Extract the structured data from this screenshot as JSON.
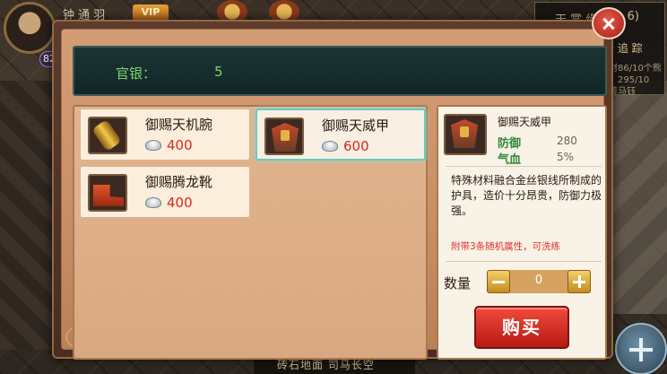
{
  "hud": {
    "player_name": "钟 通 羽",
    "vip_label": "VIP",
    "level": "82",
    "right_panel_title": "天 赏 缘",
    "right_panel_count": "6)",
    "right_panel_sub": "寿 追 踪",
    "right_panel_lines": [
      "材86/10个熊",
      "，295/10",
      "黄马钰"
    ],
    "location_text": "砖石地面    司马长空"
  },
  "dialog": {
    "silver_label": "官银：",
    "silver_value": "5",
    "items": [
      {
        "name": "御赐天机腕",
        "price": "400",
        "icon": "bracer-icon"
      },
      {
        "name": "御赐天威甲",
        "price": "600",
        "icon": "armor-icon"
      },
      {
        "name": "御赐腾龙靴",
        "price": "400",
        "icon": "boots-icon"
      }
    ],
    "detail": {
      "name": "御赐天威甲",
      "stat1_label": "防御",
      "stat1_value": "280",
      "stat2_label": "气血",
      "stat2_value": "5%",
      "description": "特殊材料融合金丝银线所制成的护具，造价十分昂贵，防御力极强。",
      "extra": "附带3条随机属性，可洗练",
      "quantity_label": "数量",
      "quantity_value": "0",
      "buy_label": "购买"
    }
  },
  "colors": {
    "silver_text": "#7ed66f",
    "price_text": "#d9281c",
    "stat_label": "#2f8a3a",
    "extra_text": "#e0322a",
    "buy_button": "#d8291d",
    "selected_border": "#6ec8c0"
  }
}
